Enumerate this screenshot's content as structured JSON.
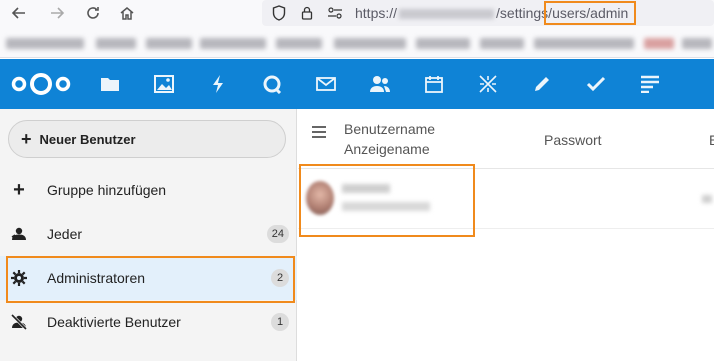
{
  "browser": {
    "url_scheme": "https://",
    "url_path": "/settings/",
    "url_highlighted_path": "users/admin"
  },
  "header": {
    "apps": [
      "files-icon",
      "photos-icon",
      "activity-icon",
      "talk-icon",
      "mail-icon",
      "contacts-icon",
      "calendar-icon",
      "deck-icon",
      "notes-icon",
      "tasks-icon",
      "list-icon"
    ]
  },
  "sidebar": {
    "new_user_label": "Neuer Benutzer",
    "add_group_label": "Gruppe hinzufügen",
    "items": [
      {
        "label": "Jeder",
        "count": "24"
      },
      {
        "label": "Administratoren",
        "count": "2"
      },
      {
        "label": "Deaktivierte Benutzer",
        "count": "1"
      }
    ]
  },
  "table": {
    "header_username": "Benutzername",
    "header_displayname": "Anzeigename",
    "header_password": "Passwort",
    "header_next": "E"
  },
  "colors": {
    "brand": "#0f83d6",
    "highlight": "#f08a1c"
  }
}
